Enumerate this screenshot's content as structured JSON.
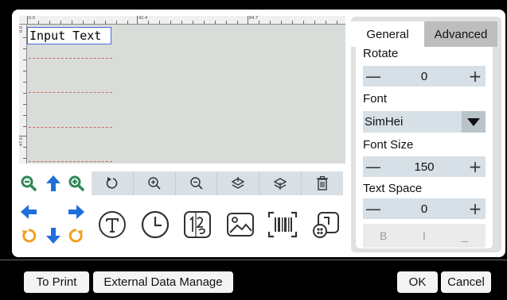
{
  "ruler": {
    "top_labels": [
      "0.0",
      "42.4",
      "84.7"
    ],
    "left_labels": [
      "0.0",
      "47.6"
    ]
  },
  "canvas": {
    "text_object": "Input Text"
  },
  "canvas_toolbar": {
    "icons": [
      "rotate-icon",
      "zoom-in-icon",
      "zoom-out-icon",
      "layer-up-icon",
      "layer-down-icon",
      "delete-icon"
    ]
  },
  "arrow_pad": {
    "icons": [
      "zoom-out-icon",
      "arrow-up-icon",
      "zoom-in-icon",
      "arrow-left-icon",
      "arrow-right-icon",
      "rotate-ccw-icon",
      "arrow-down-icon",
      "rotate-cw-icon"
    ],
    "colors": {
      "zoom": "#2e8b57",
      "arrow": "#1e6fd9",
      "rotate": "#f0a020"
    }
  },
  "object_row": {
    "icons": [
      "text-object-icon",
      "clock-object-icon",
      "serial-number-icon",
      "image-object-icon",
      "barcode-object-icon",
      "shape-object-icon"
    ]
  },
  "properties": {
    "tabs": [
      {
        "label": "General"
      },
      {
        "label": "Advanced"
      }
    ],
    "rotate": {
      "label": "Rotate",
      "value": "0",
      "minus": "—",
      "plus": "+"
    },
    "font": {
      "label": "Font",
      "value": "SimHei"
    },
    "font_size": {
      "label": "Font Size",
      "value": "150",
      "minus": "—",
      "plus": "+"
    },
    "text_space": {
      "label": "Text Space",
      "value": "0",
      "minus": "—",
      "plus": "+"
    },
    "style_buttons": {
      "bold": "B",
      "italic": "I",
      "underline": "_"
    }
  },
  "footer": {
    "to_print": "To Print",
    "external_data": "External Data Manage",
    "ok": "OK",
    "cancel": "Cancel"
  }
}
